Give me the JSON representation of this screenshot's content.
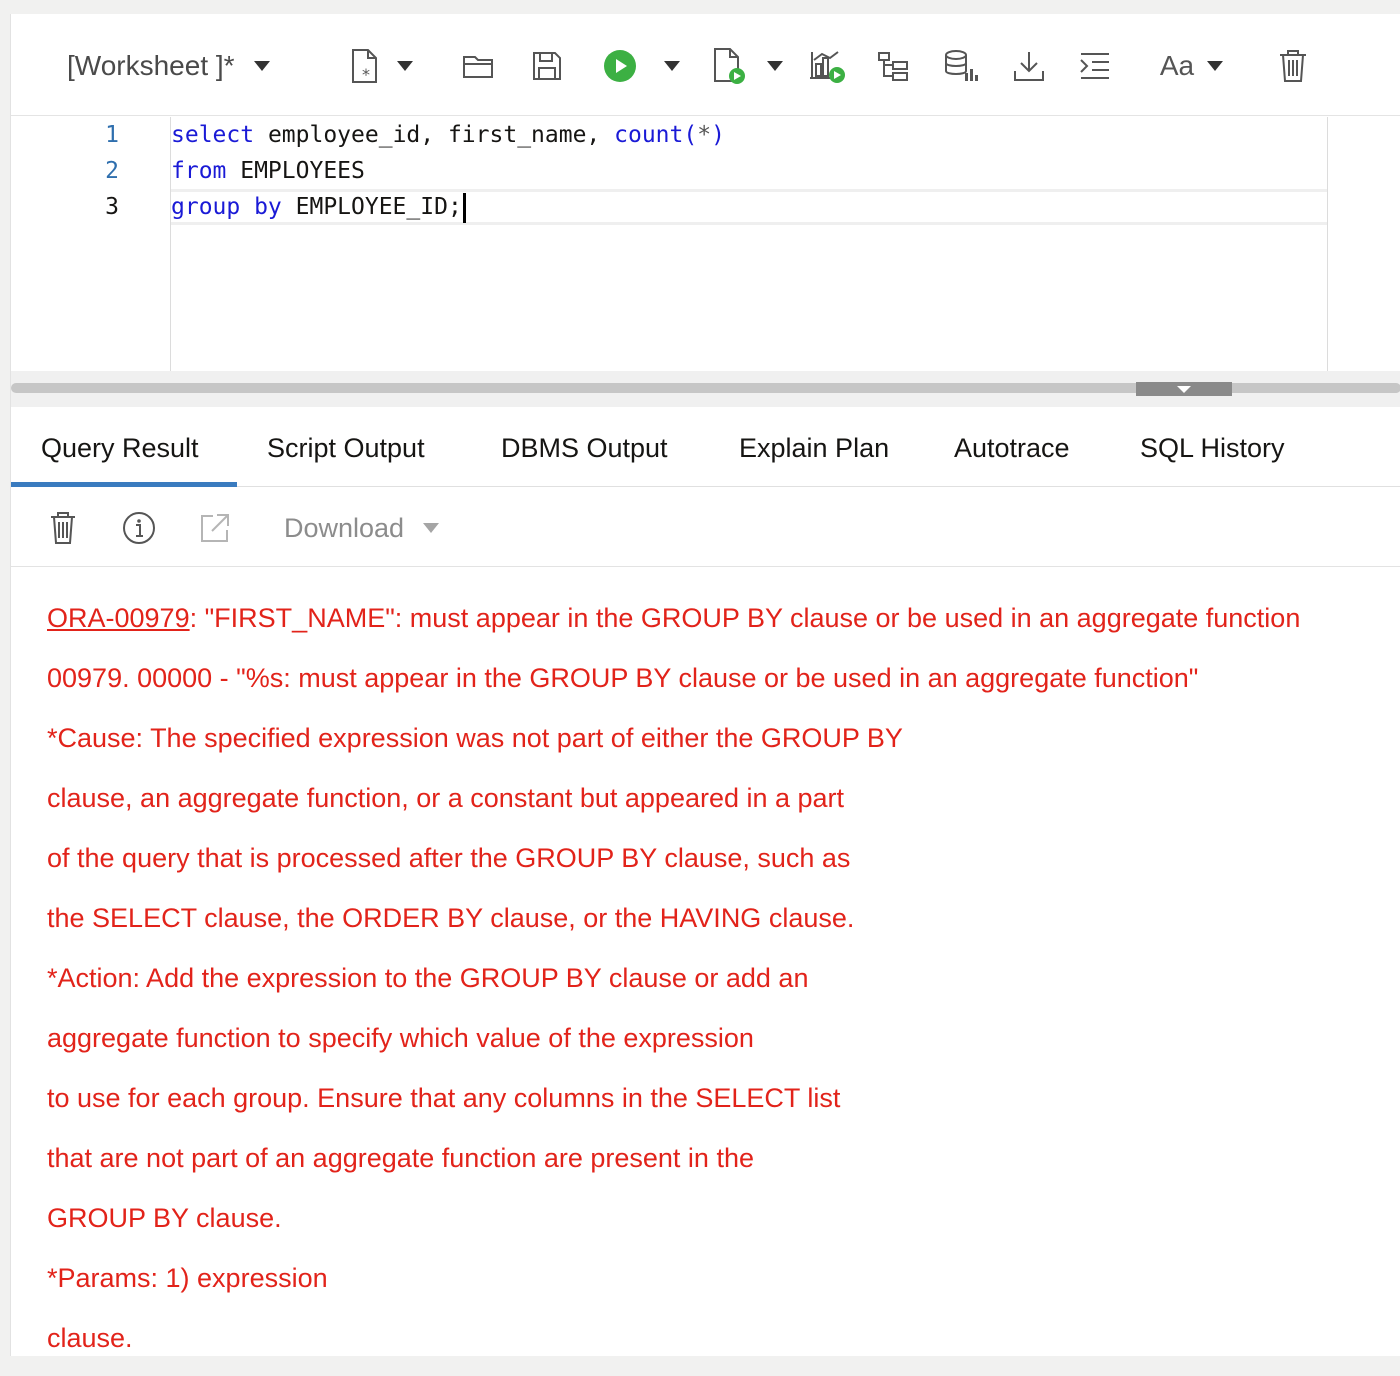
{
  "toolbar": {
    "worksheet_label": "[Worksheet ]*",
    "icons": [
      "new-worksheet-icon",
      "open-icon",
      "save-icon",
      "run-statement-icon",
      "run-script-icon",
      "explain-plan-icon",
      "autotrace-icon",
      "sql-tuning-icon",
      "download-icon",
      "format-icon",
      "font-size-icon",
      "clear-icon"
    ],
    "font_label": "Aa"
  },
  "editor": {
    "lines": [
      {
        "num": "1",
        "kw1": "select",
        "t1": " employee_id, first_name, ",
        "kw2": "count(",
        "t2": "*",
        "kw3": ")"
      },
      {
        "num": "2",
        "kw1": "from",
        "t1": " EMPLOYEES"
      },
      {
        "num": "3",
        "kw1": "group by",
        "t1": " EMPLOYEE_ID;"
      }
    ]
  },
  "tabs": [
    {
      "label": "Query Result",
      "active": true
    },
    {
      "label": "Script Output"
    },
    {
      "label": "DBMS Output"
    },
    {
      "label": "Explain Plan"
    },
    {
      "label": "Autotrace"
    },
    {
      "label": "SQL History"
    }
  ],
  "result_toolbar": {
    "download_label": "Download"
  },
  "output": {
    "error_code": "ORA-00979",
    "first_line_rest": ": \"FIRST_NAME\": must appear in the GROUP BY clause or be used in an aggregate function",
    "lines": [
      "00979. 00000 -  \"%s: must appear in the GROUP BY clause or be used in an aggregate function\"",
      "*Cause:    The specified expression was not part of either the GROUP BY",
      "clause, an aggregate function, or a constant but appeared in a part",
      "of the query that is processed after the GROUP BY clause, such as",
      "the SELECT clause, the ORDER BY clause, or the HAVING clause.",
      "*Action:   Add the expression to the GROUP BY clause or add an",
      "aggregate function to specify which value of the expression",
      "to use for each group. Ensure that any columns in the SELECT list",
      "that are not part of an aggregate function are present in the",
      "GROUP BY clause.",
      "*Params: 1) expression",
      "clause."
    ]
  },
  "colors": {
    "error": "#e2231a",
    "keyword": "#1a1ad6",
    "line_number": "#2f6fae",
    "tab_active": "#3a7bbf",
    "run_green": "#3cb043"
  }
}
